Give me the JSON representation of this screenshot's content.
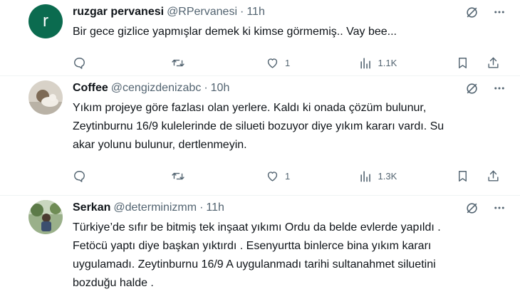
{
  "tweets": [
    {
      "name": "ruzgar pervanesi",
      "handle": "@RPervanesi",
      "separator": "·",
      "time": "11h",
      "avatar_letter": "r",
      "avatar_color": "#0b6b4f",
      "lines": [
        "Bir gece gizlice yapmışlar demek ki kimse görmemiş.. Vay bee..."
      ],
      "stats": {
        "replies": "",
        "reposts": "",
        "likes": "1",
        "views": "1.1K"
      }
    },
    {
      "name": "Coffee",
      "handle": "@cengizdenizabc",
      "separator": "·",
      "time": "10h",
      "avatar_letter": "",
      "avatar_color": "#c8c3bd",
      "lines": [
        "Yıkım projeye göre fazlası olan yerlere. Kaldı ki onada çözüm bulunur,",
        "Zeytinburnu 16/9 kulelerinde de silueti bozuyor diye yıkım kararı vardı. Su",
        "akar yolunu bulunur, dertlenmeyin."
      ],
      "stats": {
        "replies": "",
        "reposts": "",
        "likes": "1",
        "views": "1.3K"
      }
    },
    {
      "name": "Serkan",
      "handle": "@determinizmm",
      "separator": "·",
      "time": "11h",
      "avatar_letter": "",
      "avatar_color": "#6d8a5a",
      "lines": [
        "Türkiye’de sıfır be bitmiş tek inşaat yıkımı Ordu da belde evlerde yapıldı .",
        "Fetöcü yaptı diye başkan yıktırdı . Esenyurtta binlerce bina yıkım kararı",
        "uygulamadı. Zeytinburnu 16/9 A uygulanmadı tarihi sultanahmet siluetini",
        "bozduğu halde ."
      ],
      "stats": {
        "replies": "",
        "reposts": "",
        "likes": "",
        "views": ""
      }
    }
  ],
  "icons": {
    "grok": "grok-icon",
    "more": "more-icon",
    "reply": "reply-icon",
    "repost": "repost-icon",
    "like": "like-icon",
    "views": "views-icon",
    "bookmark": "bookmark-icon",
    "share": "share-icon"
  },
  "colors": {
    "text": "#0f1419",
    "secondary": "#536471",
    "divider": "#eff3f4"
  }
}
